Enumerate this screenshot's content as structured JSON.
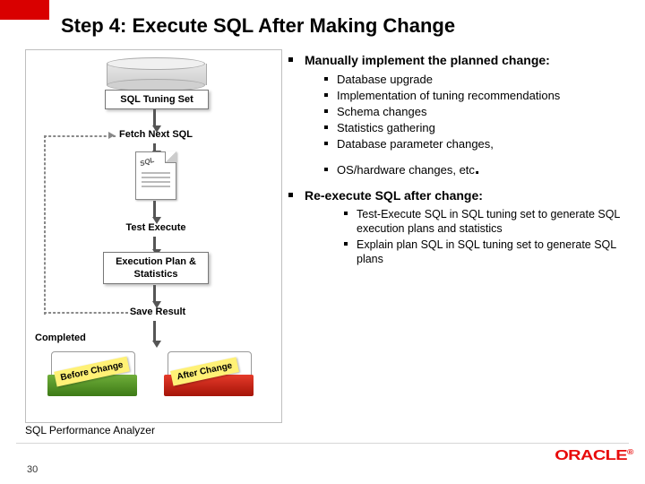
{
  "header": {
    "title": "Step 4: Execute SQL After Making Change"
  },
  "diagram": {
    "sql_tuning_set": "SQL Tuning Set",
    "fetch_next_sql": "Fetch Next SQL",
    "test_execute": "Test Execute",
    "execution_plan_stats_l1": "Execution Plan &",
    "execution_plan_stats_l2": "Statistics",
    "save_result": "Save Result",
    "completed": "Completed",
    "book_before": "Before Change",
    "book_after": "After Change",
    "analyzer_label": "SQL Performance Analyzer",
    "doc_badge": "SQL"
  },
  "bullets": {
    "main1": "Manually implement the planned change:",
    "sub1": "Database upgrade",
    "sub2": "Implementation of tuning recommendations",
    "sub3": "Schema changes",
    "sub4": "Statistics gathering",
    "sub5": "Database parameter changes,",
    "sub6a": "OS/hardware changes, etc",
    "sub6b": ".",
    "main2": "Re-execute SQL after change:",
    "sub7": "Test-Execute SQL in SQL tuning set to generate SQL execution plans and statistics",
    "sub8": "Explain plan SQL in SQL tuning set to generate SQL plans"
  },
  "footer": {
    "page": "30",
    "brand": "ORACLE",
    "reg": "®"
  }
}
